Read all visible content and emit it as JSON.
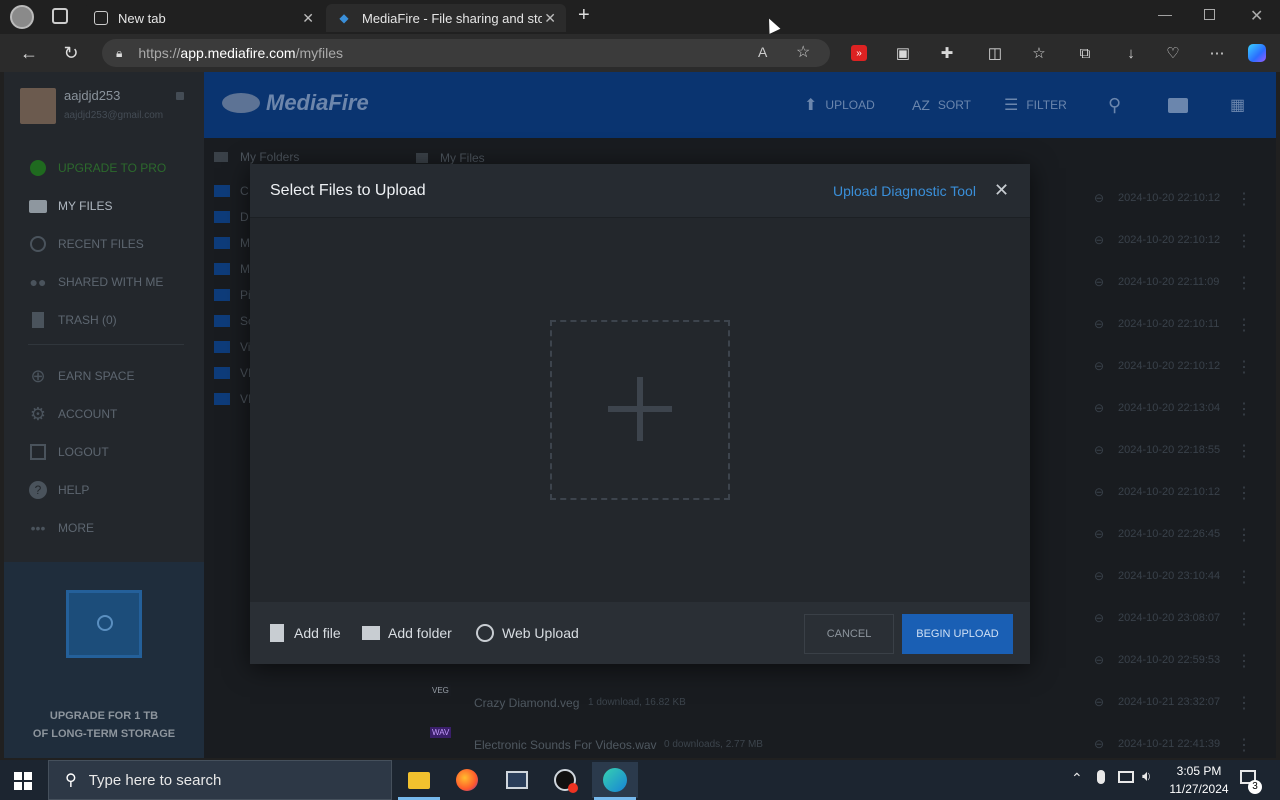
{
  "browser": {
    "tabs": [
      {
        "title": "New tab"
      },
      {
        "title": "MediaFire - File sharing and stora"
      }
    ],
    "url_prefix": "https://",
    "url_host": "app.mediafire.com",
    "url_path": "/myfiles"
  },
  "sidebar": {
    "username": "aajdjd253",
    "email": "aajdjd253@gmail.com",
    "items": [
      {
        "label": "UPGRADE TO PRO"
      },
      {
        "label": "MY FILES"
      },
      {
        "label": "RECENT FILES"
      },
      {
        "label": "SHARED WITH ME"
      },
      {
        "label": "TRASH (0)"
      },
      {
        "label": "EARN SPACE"
      },
      {
        "label": "ACCOUNT"
      },
      {
        "label": "LOGOUT"
      },
      {
        "label": "HELP"
      },
      {
        "label": "MORE"
      }
    ],
    "promo_line1": "UPGRADE FOR 1 TB",
    "promo_line2": "OF LONG-TERM STORAGE"
  },
  "header": {
    "logo": "MediaFire",
    "upload": "UPLOAD",
    "sort": "SORT",
    "filter": "FILTER"
  },
  "breadcrumbs": {
    "left": "My Folders",
    "right": "My Files"
  },
  "folders": [
    "C",
    "D",
    "M",
    "M",
    "Pi",
    "Sc",
    "Vi",
    "VI",
    "VI"
  ],
  "files": {
    "dates": [
      "2024-10-20 22:10:12",
      "2024-10-20 22:10:12",
      "2024-10-20 22:11:09",
      "2024-10-20 22:10:11",
      "2024-10-20 22:10:12",
      "2024-10-20 22:13:04",
      "2024-10-20 22:18:55",
      "2024-10-20 22:10:12",
      "2024-10-20 22:26:45",
      "2024-10-20 23:10:44",
      "2024-10-20 23:08:07",
      "2024-10-20 22:59:53",
      "2024-10-21 23:32:07",
      "2024-10-21 22:41:39"
    ],
    "named": [
      {
        "badge": "VEG",
        "name": "Crazy Diamond.veg",
        "meta": "1 download, 16.82 KB"
      },
      {
        "badge": "WAV",
        "name": "Electronic Sounds For Videos.wav",
        "meta": "0 downloads, 2.77 MB"
      }
    ]
  },
  "modal": {
    "title": "Select Files to Upload",
    "diag_link": "Upload Diagnostic Tool",
    "add_file": "Add file",
    "add_folder": "Add folder",
    "web_upload": "Web Upload",
    "cancel": "CANCEL",
    "begin": "BEGIN UPLOAD"
  },
  "taskbar": {
    "search_placeholder": "Type here to search",
    "time": "3:05 PM",
    "date": "11/27/2024",
    "notifications": "3"
  },
  "colors": {
    "accent_blue": "#1a5fb4",
    "header_blue": "#0a3470",
    "link_blue": "#3a8fd9"
  }
}
